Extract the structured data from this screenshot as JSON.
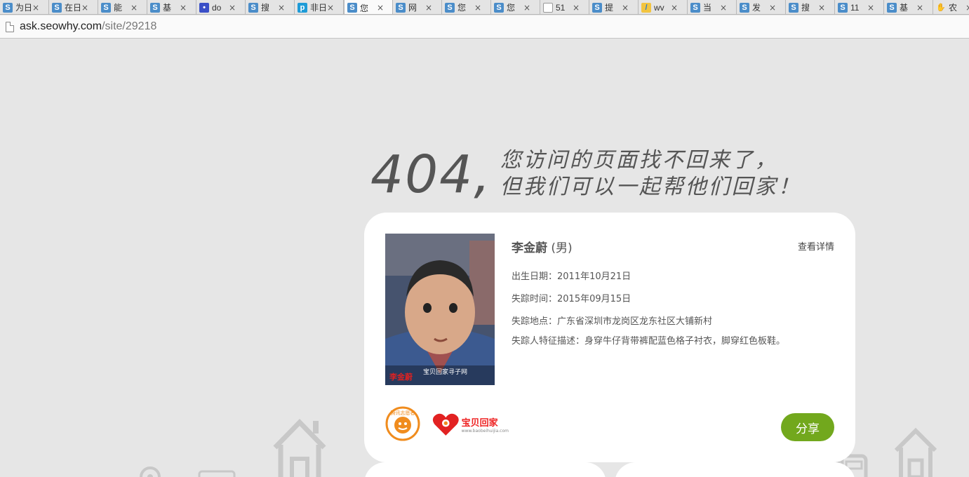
{
  "browser": {
    "tabs": [
      {
        "favicon": "S",
        "title": "为日"
      },
      {
        "favicon": "S",
        "title": "在日"
      },
      {
        "favicon": "S",
        "title": "能"
      },
      {
        "favicon": "S",
        "title": "基"
      },
      {
        "favicon": "paw",
        "title": "do"
      },
      {
        "favicon": "S",
        "title": "搜"
      },
      {
        "favicon": "p",
        "title": "非日"
      },
      {
        "favicon": "S",
        "title": "您",
        "active": true
      },
      {
        "favicon": "S",
        "title": "网"
      },
      {
        "favicon": "S",
        "title": "您"
      },
      {
        "favicon": "S",
        "title": "您"
      },
      {
        "favicon": "doc",
        "title": "51"
      },
      {
        "favicon": "S",
        "title": "提"
      },
      {
        "favicon": "w",
        "title": "wv"
      },
      {
        "favicon": "S",
        "title": "当"
      },
      {
        "favicon": "S",
        "title": "发"
      },
      {
        "favicon": "S",
        "title": "搜"
      },
      {
        "favicon": "S",
        "title": "11"
      },
      {
        "favicon": "S",
        "title": "基"
      },
      {
        "favicon": "clap",
        "title": "农"
      }
    ],
    "close_glyph": "×",
    "url_host": "ask.seowhy.com",
    "url_path": "/site/29218"
  },
  "headline": {
    "code": "404,",
    "line1": "您访问的页面找不回来了，",
    "line2": "但我们可以一起帮他们回家！"
  },
  "card": {
    "name": "李金蔚",
    "gender": "(男)",
    "detail_link": "查看详情",
    "birth_label": "出生日期：",
    "birth_value": "2011年10月21日",
    "missing_time_label": "失踪时间：",
    "missing_time_value": "2015年09月15日",
    "missing_place_label": "失踪地点：",
    "missing_place_value": "广东省深圳市龙岗区龙东社区大铺新村",
    "features_label": "失踪人特征描述：",
    "features_value": "身穿牛仔背带裤配蓝色格子衬衣，脚穿红色板鞋。",
    "photo_caption_name": "李金蔚",
    "photo_caption_site": "宝贝回家寻子网",
    "partner_logo1": "腾讯志愿者",
    "partner_logo2": "宝贝回家",
    "partner_logo2_url": "www.baobeihuijia.com",
    "share_label": "分享"
  },
  "colors": {
    "background": "#e6e6e6",
    "card": "#ffffff",
    "share_button": "#72a81d",
    "text": "#555555",
    "logo_orange": "#f08c1e",
    "logo_red": "#e22222"
  },
  "icons": [
    "page-icon",
    "house-icon",
    "location-pin-icon",
    "bus-icon"
  ]
}
